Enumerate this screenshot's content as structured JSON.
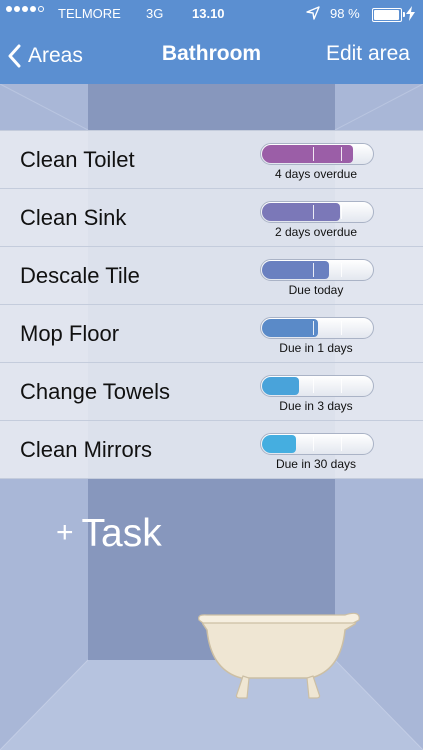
{
  "status_bar": {
    "carrier": "TELMORE",
    "network": "3G",
    "time": "13.10",
    "battery_percent": "98 %",
    "battery_level": 0.98,
    "signal_bars_filled": 4,
    "signal_bars_total": 5,
    "icons": [
      "location-arrow-icon",
      "battery-icon",
      "charging-bolt-icon"
    ]
  },
  "nav": {
    "back_label": "Areas",
    "title": "Bathroom",
    "edit_label": "Edit area",
    "color": "#5b8fd1"
  },
  "tasks": [
    {
      "name": "Clean Toilet",
      "due": "4 days overdue",
      "progress": 0.81,
      "color": "#9b5ea7"
    },
    {
      "name": "Clean Sink",
      "due": "2 days overdue",
      "progress": 0.7,
      "color": "#7b78b8"
    },
    {
      "name": "Descale Tile",
      "due": "Due today",
      "progress": 0.6,
      "color": "#6a80c0"
    },
    {
      "name": "Mop Floor",
      "due": "Due in 1 days",
      "progress": 0.5,
      "color": "#5a8ac8"
    },
    {
      "name": "Change Towels",
      "due": "Due in 3 days",
      "progress": 0.33,
      "color": "#49a3da"
    },
    {
      "name": "Clean Mirrors",
      "due": "Due in 30 days",
      "progress": 0.3,
      "color": "#45aee0"
    }
  ],
  "add_task": {
    "plus": "+",
    "label": "Task"
  },
  "area_icon": "bathtub-icon"
}
